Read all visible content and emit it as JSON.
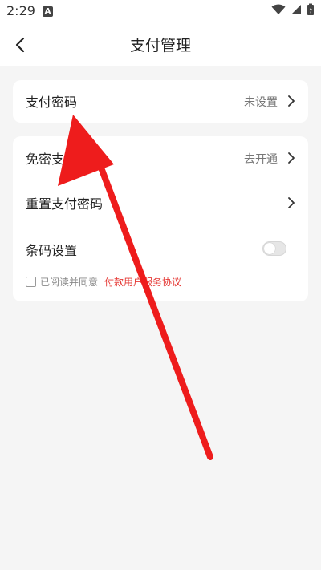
{
  "status_bar": {
    "time": "2:29",
    "notification_icon_letter": "A",
    "icons": [
      "wifi-icon",
      "cellular-icon",
      "battery-icon"
    ]
  },
  "header": {
    "title": "支付管理",
    "back_icon": "back-icon"
  },
  "card1": {
    "rows": [
      {
        "label": "支付密码",
        "value": "未设置"
      }
    ]
  },
  "card2": {
    "rows": [
      {
        "label": "免密支付设置",
        "value": "去开通"
      },
      {
        "label": "重置支付密码",
        "value": ""
      },
      {
        "label": "条码设置",
        "toggle_on": false
      }
    ],
    "agreement": {
      "text": "已阅读并同意",
      "link": "付款用户服务协议",
      "checked": false
    }
  },
  "colors": {
    "accent_red": "#e53935",
    "background": "#f5f5f5",
    "card": "#ffffff"
  }
}
